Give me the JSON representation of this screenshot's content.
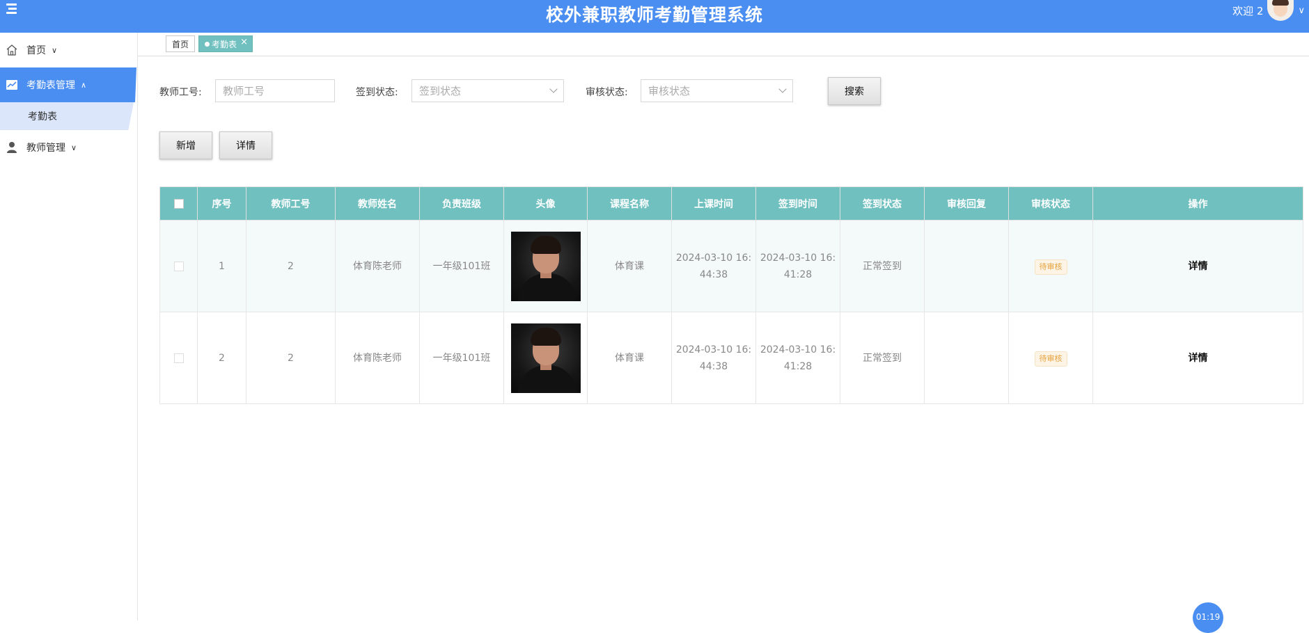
{
  "header": {
    "title": "校外兼职教师考勤管理系统",
    "welcome": "欢迎 2"
  },
  "sidebar": {
    "items": [
      {
        "label": "首页",
        "icon": "home-icon"
      },
      {
        "label": "考勤表管理",
        "icon": "chart-icon",
        "sub": [
          {
            "label": "考勤表"
          }
        ]
      },
      {
        "label": "教师管理",
        "icon": "user-icon"
      }
    ],
    "active_color": "#4a8ef2"
  },
  "tabs": {
    "home": "首页",
    "current": "考勤表",
    "close": "×"
  },
  "search": {
    "teacher_no_label": "教师工号:",
    "teacher_no_placeholder": "教师工号",
    "sign_status_label": "签到状态:",
    "sign_status_placeholder": "签到状态",
    "audit_status_label": "审核状态:",
    "audit_status_placeholder": "审核状态",
    "search_btn": "搜索"
  },
  "actions": {
    "add": "新增",
    "detail": "详情"
  },
  "table": {
    "header_color": "#71c0c0",
    "columns": [
      "序号",
      "教师工号",
      "教师姓名",
      "负责班级",
      "头像",
      "课程名称",
      "上课时间",
      "签到时间",
      "签到状态",
      "审核回复",
      "审核状态",
      "操作"
    ],
    "rows": [
      {
        "no": "1",
        "teacher_no": "2",
        "name": "体育陈老师",
        "class": "一年级101班",
        "course": "体育课",
        "class_time_1": "2024-03-10 16:",
        "class_time_2": "44:38",
        "sign_time_1": "2024-03-10 16:",
        "sign_time_2": "41:28",
        "sign_status": "正常签到",
        "reply": "",
        "audit": "待审核",
        "op": "详情"
      },
      {
        "no": "2",
        "teacher_no": "2",
        "name": "体育陈老师",
        "class": "一年级101班",
        "course": "体育课",
        "class_time_1": "2024-03-10 16:",
        "class_time_2": "44:38",
        "sign_time_1": "2024-03-10 16:",
        "sign_time_2": "41:28",
        "sign_status": "正常签到",
        "reply": "",
        "audit": "待审核",
        "op": "详情"
      }
    ]
  },
  "timer": "01:19"
}
